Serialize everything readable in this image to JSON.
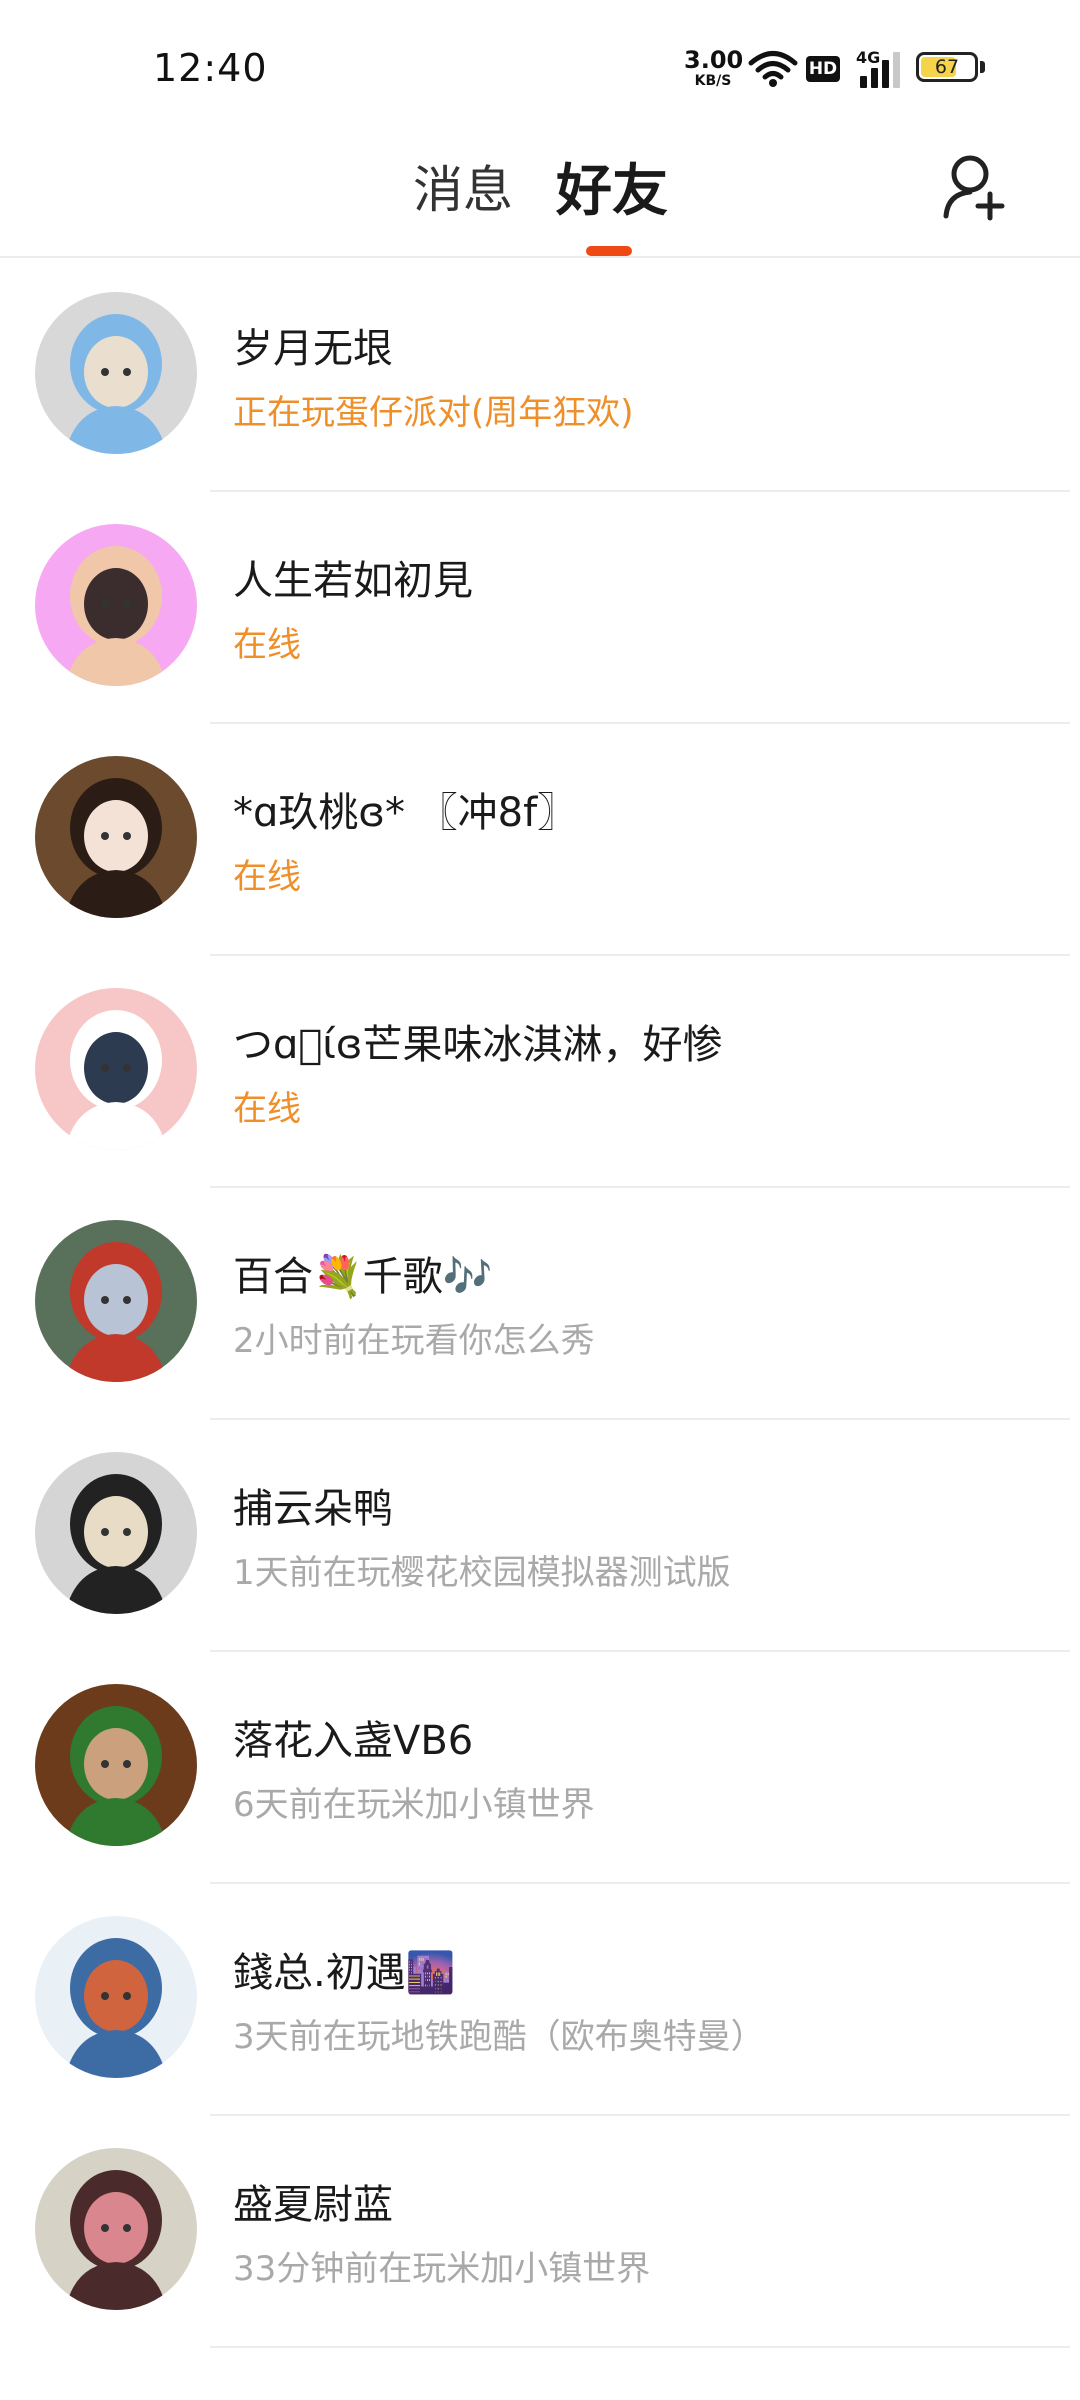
{
  "status_bar": {
    "time": "12:40",
    "net_speed": "3.00",
    "net_speed_unit": "KB/S",
    "hd_label": "HD",
    "network_type": "4G",
    "battery_level": "67",
    "battery_fraction": 0.67,
    "battery_color": "#f5d34a"
  },
  "header": {
    "tabs": [
      {
        "label": "消息",
        "selected": false
      },
      {
        "label": "好友",
        "selected": true
      }
    ],
    "accent_color": "#ef4a16",
    "add_friend_icon": "add-user-icon"
  },
  "friends": [
    {
      "name": "岁月无垠",
      "status": "正在玩蛋仔派对(周年狂欢)",
      "online": true,
      "avatar_colors": [
        "#d8d8d8",
        "#eadfce",
        "#7fb8e6"
      ]
    },
    {
      "name": "人生若如初見",
      "status": "在线",
      "online": true,
      "avatar_colors": [
        "#f6a8f2",
        "#3b2d2d",
        "#f0c7a8"
      ]
    },
    {
      "name": "*ɑ玖桃ɞ* 〖冲8f〗",
      "status": "在线",
      "online": true,
      "avatar_colors": [
        "#6b4a2e",
        "#f4e2d6",
        "#2b1d16"
      ]
    },
    {
      "name": "つɑ᪶ίɞ芒果味冰淇淋，好惨",
      "status": "在线",
      "online": true,
      "avatar_colors": [
        "#f7c6c6",
        "#2c3b50",
        "#ffffff"
      ]
    },
    {
      "name": "百合💐千歌🎶",
      "status": "2小时前在玩看你怎么秀",
      "online": false,
      "avatar_colors": [
        "#59705a",
        "#b9c3d6",
        "#c0392b"
      ]
    },
    {
      "name": "捕云朵鸭",
      "status": "1天前在玩樱花校园模拟器测试版",
      "online": false,
      "avatar_colors": [
        "#d5d5d5",
        "#e8dcc7",
        "#222222"
      ]
    },
    {
      "name": "落花入盏VB6",
      "status": "6天前在玩米加小镇世界",
      "online": false,
      "avatar_colors": [
        "#6b3b1c",
        "#caa17c",
        "#2f7a2f"
      ]
    },
    {
      "name": "錢总.初遇🌆",
      "status": "3天前在玩地铁跑酷（欧布奥特曼）",
      "online": false,
      "avatar_colors": [
        "#e9f0f6",
        "#d0643f",
        "#3d6ba3"
      ]
    },
    {
      "name": "盛夏尉蓝",
      "status": "33分钟前在玩米加小镇世界",
      "online": false,
      "avatar_colors": [
        "#d6d2c6",
        "#d9868e",
        "#4a2a2a"
      ]
    }
  ],
  "colors": {
    "online_status": "#ef8f2a",
    "offline_status": "#a9a9a9"
  }
}
